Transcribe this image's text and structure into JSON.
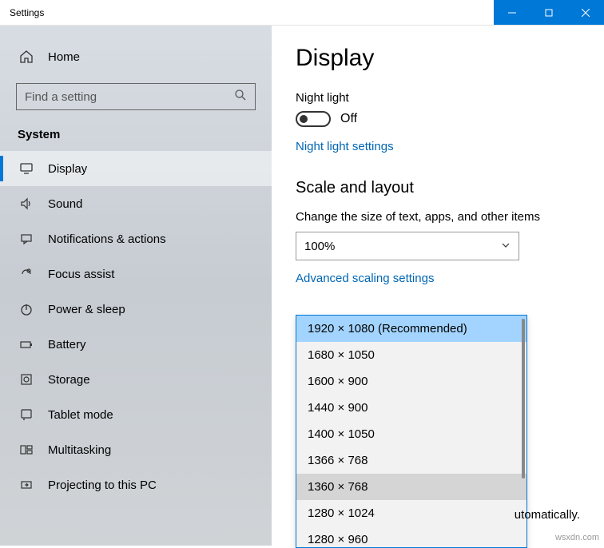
{
  "window": {
    "title": "Settings"
  },
  "sidebar": {
    "home": "Home",
    "search_placeholder": "Find a setting",
    "category": "System",
    "items": [
      {
        "label": "Display",
        "icon": "display-icon",
        "selected": true
      },
      {
        "label": "Sound",
        "icon": "sound-icon"
      },
      {
        "label": "Notifications & actions",
        "icon": "notifications-icon"
      },
      {
        "label": "Focus assist",
        "icon": "focus-icon"
      },
      {
        "label": "Power & sleep",
        "icon": "power-icon"
      },
      {
        "label": "Battery",
        "icon": "battery-icon"
      },
      {
        "label": "Storage",
        "icon": "storage-icon"
      },
      {
        "label": "Tablet mode",
        "icon": "tablet-icon"
      },
      {
        "label": "Multitasking",
        "icon": "multitasking-icon"
      },
      {
        "label": "Projecting to this PC",
        "icon": "projecting-icon"
      }
    ]
  },
  "content": {
    "page_title": "Display",
    "night_light_label": "Night light",
    "night_light_state": "Off",
    "night_light_link": "Night light settings",
    "scale_heading": "Scale and layout",
    "scale_desc": "Change the size of text, apps, and other items",
    "scale_value": "100%",
    "adv_scaling_link": "Advanced scaling settings",
    "resolution_options": [
      "1920 × 1080 (Recommended)",
      "1680 × 1050",
      "1600 × 900",
      "1440 × 900",
      "1400 × 1050",
      "1366 × 768",
      "1360 × 768",
      "1280 × 1024",
      "1280 × 960"
    ],
    "resolution_selected_index": 0,
    "resolution_hover_index": 6,
    "footer_fragment": "utomatically."
  },
  "watermark": "wsxdn.com"
}
